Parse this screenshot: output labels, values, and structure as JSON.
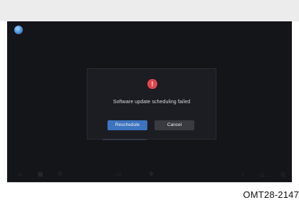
{
  "dialog": {
    "message": "Software update scheduling failed",
    "primary_button": "Reschedule",
    "secondary_button": "Cancel",
    "icon": "error-icon"
  },
  "status_bar": {
    "assistant_icon": "assistant-icon"
  },
  "dock": {
    "icons": [
      "home-icon",
      "grid-icon",
      "phone-icon",
      "media-icon",
      "settings-icon",
      "music-icon",
      "navigation-icon",
      "profile-icon"
    ]
  },
  "caption": "OMT28-2147",
  "colors": {
    "screen_bg": "#141519",
    "dialog_bg": "#1c1d22",
    "primary": "#3d74c0",
    "secondary": "#3a3b40",
    "error": "#e0484d"
  }
}
